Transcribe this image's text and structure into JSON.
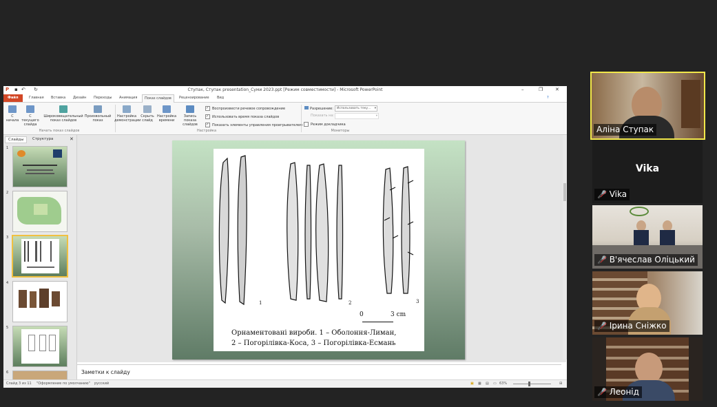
{
  "powerpoint": {
    "window_title": "Ступак, Ступак presentation_Суми 2023.ppt [Режим совместимости] - Microsoft PowerPoint",
    "tabs": [
      "Файл",
      "Главная",
      "Вставка",
      "Дизайн",
      "Переходы",
      "Анимация",
      "Показ слайдов",
      "Рецензирование",
      "Вид"
    ],
    "active_tab": "Показ слайдов",
    "ribbon": {
      "buttons": [
        "С начала",
        "С текущего слайда",
        "Широковещательный показ слайдов",
        "Произвольный показ",
        "Настройка демонстрации",
        "Скрыть слайд",
        "Настройка времени",
        "Запись показа слайдов"
      ],
      "group_start": "Начать показ слайдов",
      "group_setup": "Настройка",
      "group_monitors": "Мониторы",
      "checks": [
        "Воспроизвести речевое сопровождение",
        "Использовать время показа слайдов",
        "Показать элементы управления проигрывателем"
      ],
      "resolution_label": "Разрешение:",
      "resolution_value": "Использовать теку...",
      "show_on_label": "Показать на:",
      "presenter_view": "Режим докладчика"
    },
    "thumbs_tabs": [
      "Слайды",
      "Структура"
    ],
    "thumb_numbers": [
      "1",
      "2",
      "3",
      "4",
      "5",
      "6"
    ],
    "selected_slide": 3,
    "slide": {
      "caption_line1": "Орнаментовані вироби. 1 – Оболоння-Лиман,",
      "caption_line2": "2 – Погорілівка-Коса, 3 – Погорілівка-Есмань",
      "scale_zero": "0",
      "scale_label": "3 cm",
      "fig1": "1",
      "fig2": "2",
      "fig3": "3"
    },
    "notes_placeholder": "Заметки к слайду",
    "status": {
      "slide_info": "Слайд 3 из 11",
      "theme": "\"Оформление по умолчанию\"",
      "language": "русский",
      "zoom": "63%"
    }
  },
  "participants": [
    {
      "name": "Аліна Ступак",
      "muted": false,
      "video": true,
      "active_speaker": true
    },
    {
      "name": "Vika",
      "muted": true,
      "video": false
    },
    {
      "name": "В'ячеслав Оліцький",
      "muted": true,
      "video": true
    },
    {
      "name": "Ірина Сніжко",
      "muted": true,
      "video": true
    },
    {
      "name": "Леонід",
      "muted": true,
      "video": true
    }
  ],
  "colors": {
    "active_speaker_border": "#f2e84a",
    "file_tab": "#d24726",
    "muted_mic": "#e03030"
  }
}
